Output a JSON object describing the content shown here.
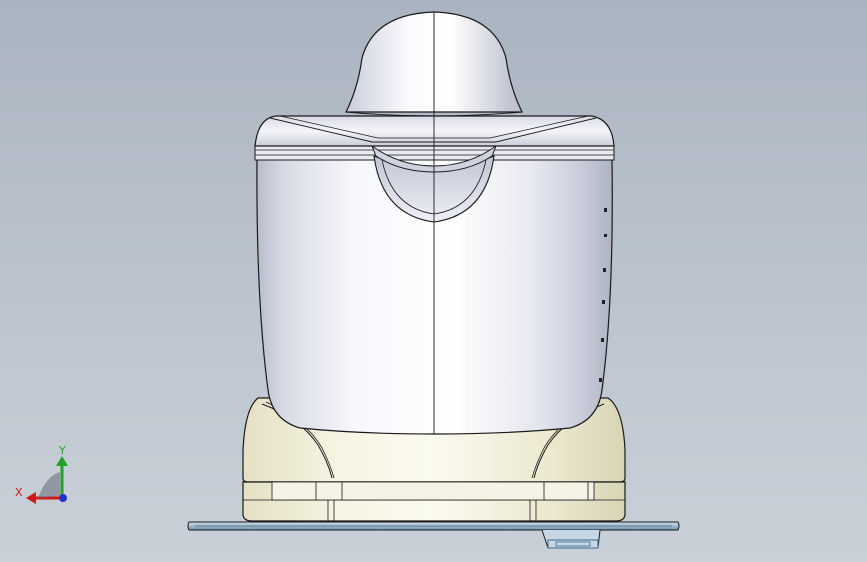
{
  "viewport": {
    "background_top": "#aab4c0",
    "background_bottom": "#c9d0d8"
  },
  "model": {
    "name": "juicer",
    "body_color": "#eef1f7",
    "base_color": "#f1efd6",
    "plate_color": "#8fb2cc",
    "edge_color": "#1a1a1a"
  },
  "triad": {
    "x_label": "X",
    "y_label": "Y",
    "x_color": "#d01a1a",
    "y_color": "#22a02a",
    "z_color": "#2030c8"
  }
}
